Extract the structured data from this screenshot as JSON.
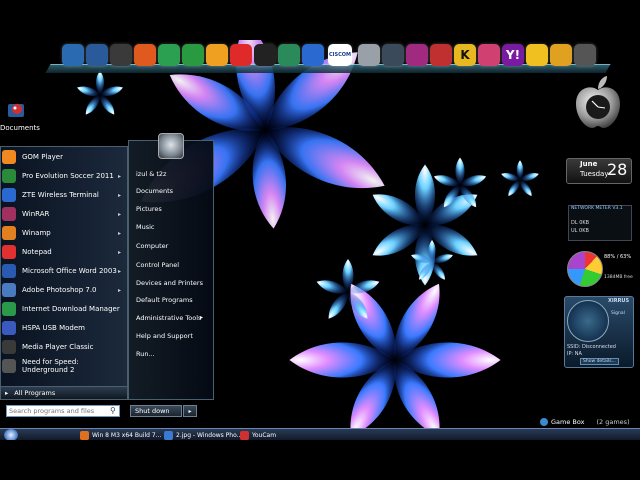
{
  "desktop": {
    "icons": [
      {
        "label": "Documents",
        "icon": "documents-icon"
      }
    ]
  },
  "dock": {
    "icons": [
      {
        "icon": "monitor-icon",
        "color": "#2a6ab0"
      },
      {
        "icon": "globe-icon",
        "color": "#2a5a9a"
      },
      {
        "icon": "sphere-icon",
        "color": "#3a3a3a"
      },
      {
        "icon": "ms-office-icon",
        "color": "#e05a20"
      },
      {
        "icon": "green-triangle-icon",
        "color": "#2aa050"
      },
      {
        "icon": "eye-icon",
        "color": "#2a9a40"
      },
      {
        "icon": "colorful-diamond-icon",
        "color": "#f0a020"
      },
      {
        "icon": "lips-icon",
        "color": "#e02a2a"
      },
      {
        "icon": "game-controller-icon",
        "color": "#222222"
      },
      {
        "icon": "spreadsheet-icon",
        "color": "#2a8a5a"
      },
      {
        "icon": "ie-icon",
        "color": "#2a6ad0"
      },
      {
        "icon": "ciscom-icon",
        "color": "#ffffff",
        "label": "CISCOM"
      },
      {
        "icon": "pen-icon",
        "color": "#9aa0a8"
      },
      {
        "icon": "tool-icon",
        "color": "#3a4a5a"
      },
      {
        "icon": "3d-icon",
        "color": "#a02a80"
      },
      {
        "icon": "tools-icon",
        "color": "#c03030"
      },
      {
        "icon": "k-icon",
        "color": "#e8b820",
        "label": "K"
      },
      {
        "icon": "brush-icon",
        "color": "#d04070"
      },
      {
        "icon": "yahoo-icon",
        "color": "#7a1aa0",
        "label": "Y!"
      },
      {
        "icon": "smiley-icon",
        "color": "#f0c020"
      },
      {
        "icon": "airplane-icon",
        "color": "#e0a020"
      },
      {
        "icon": "trash-icon",
        "color": "#555555"
      }
    ]
  },
  "start_menu": {
    "programs": [
      {
        "label": "GOM Player",
        "icon": "gom-player-icon",
        "color": "#f08a20",
        "arrow": false
      },
      {
        "label": "Pro Evolution Soccer 2011",
        "icon": "pes-icon",
        "color": "#2a8a3a",
        "arrow": true
      },
      {
        "label": "ZTE Wireless Terminal",
        "icon": "zte-icon",
        "color": "#2a6ad0",
        "arrow": true
      },
      {
        "label": "WinRAR",
        "icon": "winrar-icon",
        "color": "#a03060",
        "arrow": true
      },
      {
        "label": "Winamp",
        "icon": "winamp-icon",
        "color": "#e08020",
        "arrow": true
      },
      {
        "label": "Notepad",
        "icon": "notepad-icon",
        "color": "#e03030",
        "arrow": true
      },
      {
        "label": "Microsoft Office Word 2003",
        "icon": "word-icon",
        "color": "#2a5ab0",
        "arrow": true
      },
      {
        "label": "Adobe Photoshop 7.0",
        "icon": "photoshop-icon",
        "color": "#4a7ac0",
        "arrow": true
      },
      {
        "label": "Internet Download Manager",
        "icon": "idm-icon",
        "color": "#2a9a4a",
        "arrow": false
      },
      {
        "label": "HSPA USB Modem",
        "icon": "modem-icon",
        "color": "#3a5ac0",
        "arrow": false
      },
      {
        "label": "Media Player Classic",
        "icon": "media-player-icon",
        "color": "#3a3a3a",
        "arrow": false
      },
      {
        "label": "Need for Speed: Underground 2",
        "icon": "nfs-icon",
        "color": "#555555",
        "arrow": false
      }
    ],
    "all_programs": "All Programs",
    "search_placeholder": "Search programs and files",
    "shutdown": "Shut down",
    "right_links": [
      {
        "label": "izul & t2z",
        "arrow": false
      },
      {
        "label": "Documents",
        "arrow": false
      },
      {
        "label": "Pictures",
        "arrow": false
      },
      {
        "label": "Music",
        "arrow": false
      },
      {
        "label": "Computer",
        "arrow": false
      },
      {
        "label": "Control Panel",
        "arrow": false
      },
      {
        "label": "Devices and Printers",
        "arrow": false
      },
      {
        "label": "Default Programs",
        "arrow": false
      },
      {
        "label": "Administrative Tools",
        "arrow": true
      },
      {
        "label": "Help and Support",
        "arrow": false
      },
      {
        "label": "Run...",
        "arrow": false
      }
    ]
  },
  "gadgets": {
    "calendar": {
      "month": "June",
      "day": "Tuesday",
      "date": "28"
    },
    "network_meter": {
      "title": "NETWORK METER V3.1",
      "dl": "DL   0KB",
      "ul": "UL   0KB"
    },
    "cpu": {
      "pct": "88% / 63%",
      "free": "1384MB free"
    },
    "xirrus": {
      "brand": "XIRRUS",
      "signal": "Signal",
      "ssid": "SSID: Disconnected",
      "ip": "IP: NA",
      "details": "Show details..."
    }
  },
  "taskbar": {
    "items": [
      {
        "label": "Win 8 M3 x64 Build 7...",
        "icon": "firefox-icon",
        "color": "#e07020"
      },
      {
        "label": "2.jpg - Windows Pho...",
        "icon": "photo-viewer-icon",
        "color": "#3a7ad0"
      },
      {
        "label": "YouCam",
        "icon": "youcam-icon",
        "color": "#d03030"
      }
    ],
    "game_box": {
      "label": "Game Box",
      "count": "(2 games)"
    }
  }
}
